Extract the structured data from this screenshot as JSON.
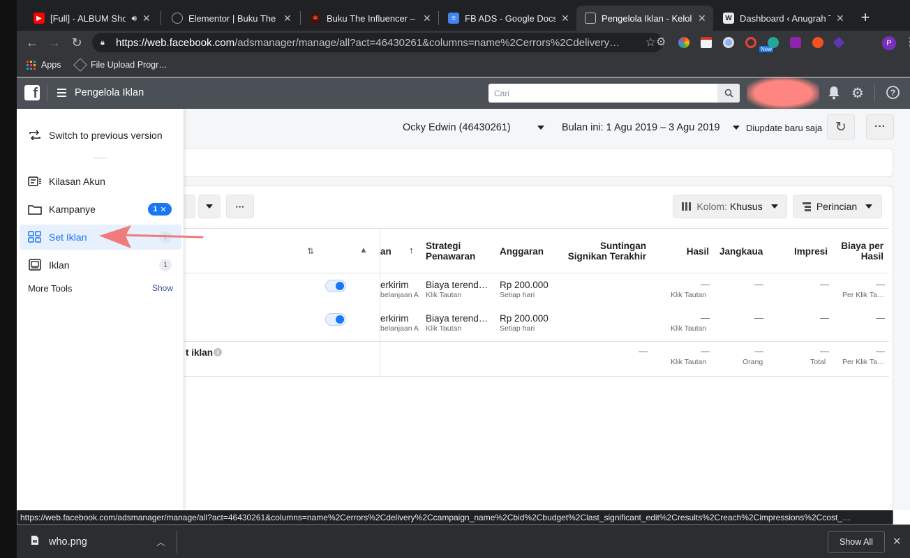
{
  "browser": {
    "tabs": [
      {
        "title": "[Full] - ALBUM Sho",
        "icon": "youtube-icon",
        "color": "#ff0000"
      },
      {
        "title": "Elementor | Buku The In",
        "icon": "globe-icon",
        "color": "#9aa0a6"
      },
      {
        "title": "Buku The Influencer – O",
        "icon": "site-icon",
        "color": "#e0452d"
      },
      {
        "title": "FB ADS - Google Docs",
        "icon": "docs-icon",
        "color": "#4285f4"
      },
      {
        "title": "Pengelola Iklan - Kelola",
        "icon": "facebook-ads-icon",
        "color": "#bdc1c6"
      },
      {
        "title": "Dashboard ‹ Anugrah T",
        "icon": "wordpress-icon",
        "color": "#e8eaed"
      }
    ],
    "url_host": "https://web.facebook.com",
    "url_path": "/adsmanager/manage/all?act=46430261&columns=name%2Cerrors%2Cdelivery…",
    "extension_badge": "New",
    "profile_initial": "P",
    "bookmarks": [
      {
        "label": "Apps"
      },
      {
        "label": "File Upload Progr…"
      }
    ],
    "status_url": "https://web.facebook.com/adsmanager/manage/all?act=46430261&columns=name%2Cerrors%2Cdelivery%2Ccampaign_name%2Cbid%2Cbudget%2Clast_significant_edit%2Cresults%2Creach%2Cimpressions%2Ccost_…",
    "download": {
      "filename": "who.png",
      "show_all": "Show All"
    }
  },
  "fb": {
    "title": "Pengelola Iklan",
    "search_placeholder": "Cari"
  },
  "sidebar": {
    "switch_label": "Switch to previous version",
    "items": [
      {
        "label": "Kilasan Akun"
      },
      {
        "label": "Kampanye",
        "count": "1",
        "close": "✕"
      },
      {
        "label": "Set Iklan",
        "count": "1"
      },
      {
        "label": "Iklan",
        "count": "1"
      }
    ],
    "more_tools": "More Tools",
    "show": "Show"
  },
  "topbar": {
    "account": "Ocky Edwin (46430261)",
    "date_range": "Bulan ini: 1 Agu 2019 – 3 Agu 2019",
    "updated": "Diupdate baru saja"
  },
  "table_toolbar": {
    "columns_prefix": "Kolom:",
    "columns_value": "Khusus",
    "breakdown": "Perincian"
  },
  "table": {
    "headers": {
      "name_partial": "an",
      "bid": [
        "Strategi",
        "Penawaran"
      ],
      "budget": "Anggaran",
      "last_edit": [
        "Suntingan",
        "Signikan Terakhir"
      ],
      "results": "Hasil",
      "reach": "Jangkaua",
      "impressions": "Impresi",
      "cost": [
        "Biaya per",
        "Hasil"
      ]
    },
    "rows": [
      {
        "delivery": "erkirim",
        "delivery_sub": "belanjaan A",
        "bid": "Biaya terend…",
        "bid_sub": "Klik Tautan",
        "budget": "Rp 200.000",
        "budget_sub": "Setiap hari",
        "results": "—",
        "results_sub": "Klik Tautan",
        "reach": "—",
        "impressions": "—",
        "cost": "—",
        "cost_sub": "Per Klik Ta…"
      },
      {
        "delivery": "erkirim",
        "delivery_sub": "belanjaan A",
        "bid": "Biaya terend…",
        "bid_sub": "Klik Tautan",
        "budget": "Rp 200.000",
        "budget_sub": "Setiap hari",
        "results": "—",
        "results_sub": "Klik Tautan",
        "reach": "—",
        "impressions": "—",
        "cost": "—",
        "cost_sub": ""
      }
    ],
    "summary": {
      "label": "t iklan",
      "last_edit": "—",
      "results": "—",
      "results_sub": "Klik Tautan",
      "reach": "—",
      "reach_sub": "Orang",
      "impressions": "—",
      "impressions_sub": "Total",
      "cost": "—",
      "cost_sub": "Per Klik Ta…"
    }
  },
  "colors": {
    "fb_header": "#4b4f56",
    "accent": "#1877f2",
    "annotation_arrow": "#f07b7b"
  }
}
